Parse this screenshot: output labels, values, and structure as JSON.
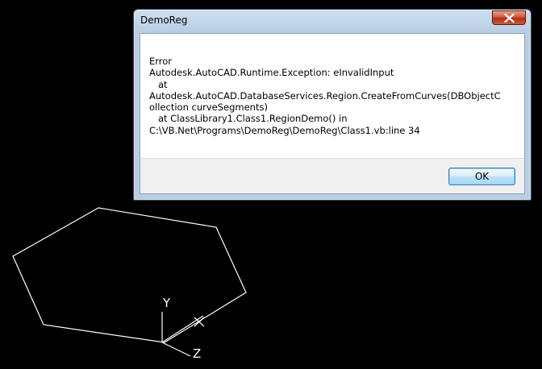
{
  "dialog": {
    "title": "DemoReg",
    "message": "Error\nAutodesk.AutoCAD.Runtime.Exception: eInvalidInput\n   at\nAutodesk.AutoCAD.DatabaseServices.Region.CreateFromCurves(DBObjectCollection curveSegments)\n   at ClassLibrary1.Class1.RegionDemo() in\nC:\\VB.Net\\Programs\\DemoReg\\DemoReg\\Class1.vb:line 34",
    "ok_label": "OK",
    "close_icon": "close-icon"
  },
  "ucs": {
    "y_label": "Y",
    "z_label": "Z"
  },
  "colors": {
    "background": "#000000",
    "geometry": "#ffffff",
    "close_button": "#c4472b",
    "ok_button_border": "#3c7fb1"
  }
}
